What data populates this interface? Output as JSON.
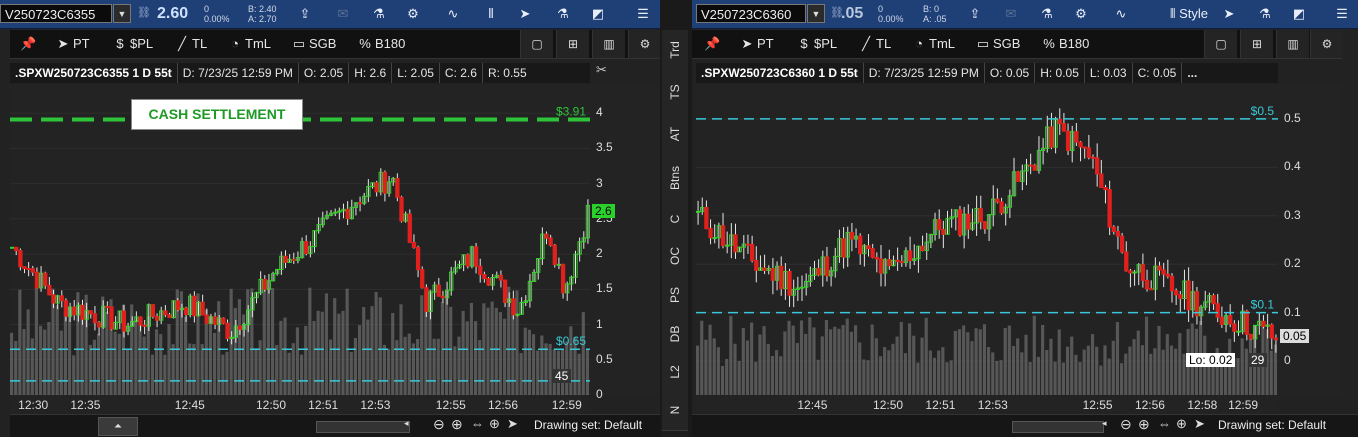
{
  "left": {
    "symbol": "V250723C6355",
    "last": "2.60",
    "change": "0",
    "change_pct": "0.00%",
    "bid": "B: 2.40",
    "ask": "A: 2.70",
    "tools": {
      "pt": "PT",
      "pl": "$PL",
      "tl": "TL",
      "tml": "TmL",
      "sgb": "SGB",
      "b180": "B180"
    },
    "info": {
      "symbol": ".SPXW250723C6355 1 D 55t",
      "date": "D: 7/23/25 12:59 PM",
      "open": "O: 2.05",
      "high": "H: 2.6",
      "low": "L: 2.05",
      "close": "C: 2.6",
      "range": "R: 0.55"
    },
    "y_ticks": [
      "4",
      "3.5",
      "3",
      "2.5",
      "2",
      "1.5",
      "1",
      "0.5",
      "0"
    ],
    "x_ticks": [
      "12:30",
      "12:35",
      "12:45",
      "12:50",
      "12:51",
      "12:53",
      "12:55",
      "12:56",
      "12:59"
    ],
    "annotation": "CASH SETTLEMENT",
    "level_high": "$3.91",
    "level_low": "$0.65",
    "price_tag": "2.6",
    "volume_tag": "45",
    "drawing_set": "Drawing set: Default"
  },
  "right": {
    "symbol": "V250723C6360",
    "last": ".05",
    "change": "0",
    "change_pct": "0.00%",
    "bid": "B: 0",
    "ask": "A: .05",
    "style_label": "Style",
    "tools": {
      "pt": "PT",
      "pl": "$PL",
      "tl": "TL",
      "tml": "TmL",
      "sgb": "SGB",
      "b180": "B180"
    },
    "info": {
      "symbol": ".SPXW250723C6360 1 D 55t",
      "date": "D: 7/23/25 12:59 PM",
      "open": "O: 0.05",
      "high": "H: 0.05",
      "low": "L: 0.03",
      "close": "C: 0.05",
      "more": "..."
    },
    "y_ticks": [
      "0.5",
      "0.4",
      "0.3",
      "0.2",
      "0.1",
      "0"
    ],
    "x_ticks": [
      "12:45",
      "12:50",
      "12:51",
      "12:53",
      "12:55",
      "12:56",
      "12:58",
      "12:59"
    ],
    "level_high": "$0.5",
    "level_low": "$0.1",
    "price_tag": "0.05",
    "low_tag": "Lo: 0.02",
    "volume_tag": "29",
    "drawing_set": "Drawing set: Default"
  },
  "side_tabs": [
    "Trd",
    "TS",
    "AT",
    "Btns",
    "C",
    "OC",
    "PS",
    "DB",
    "L2",
    "N"
  ],
  "colors": {
    "up": "#37d12b",
    "down": "#e0201c",
    "cash": "#2ec43a",
    "level": "#39c9d8",
    "volume": "#6a6a6a"
  }
}
